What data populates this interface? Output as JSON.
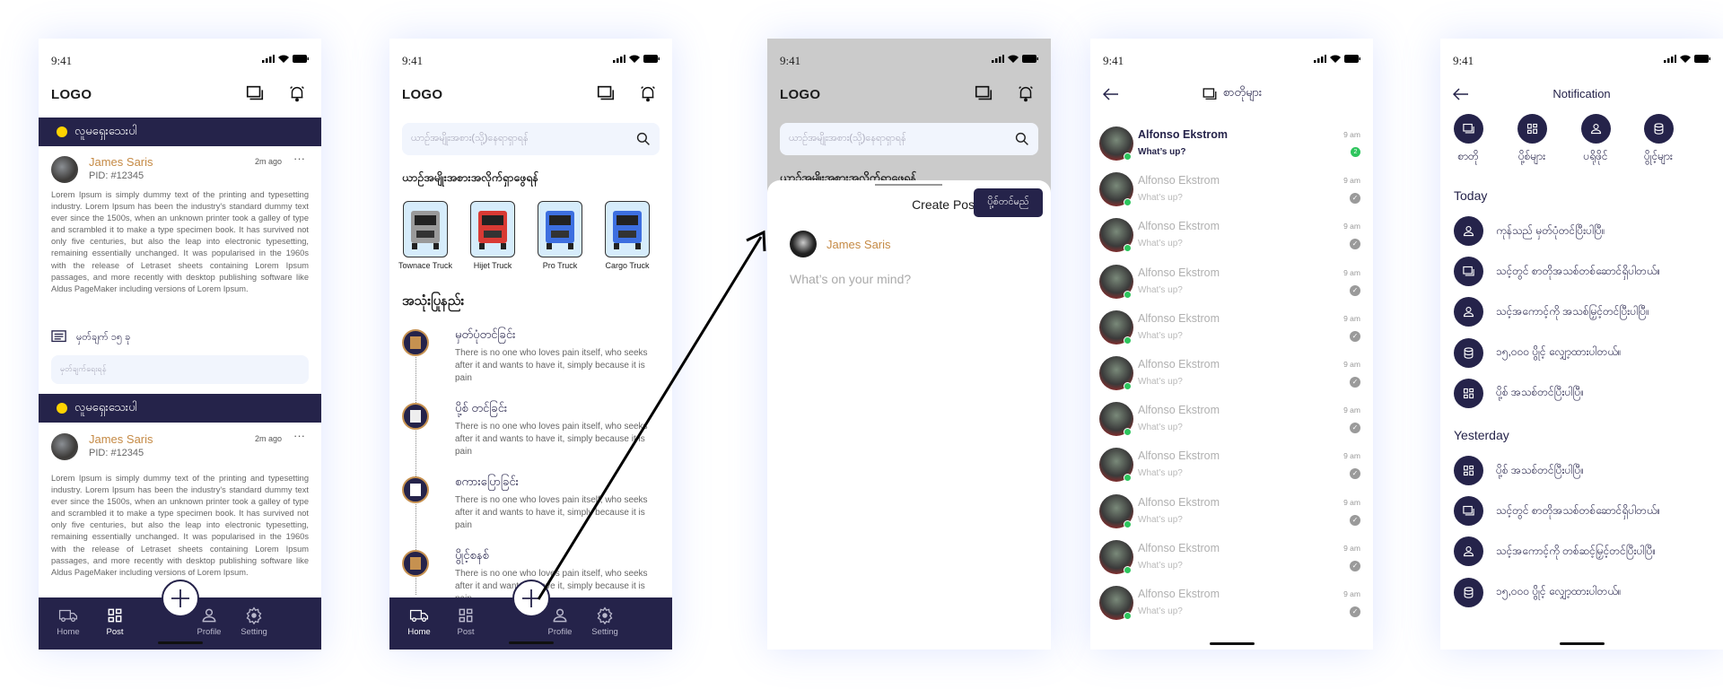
{
  "status_time": "9:41",
  "logo": "LOGO",
  "colors": {
    "primary": "#25234a",
    "accent": "#c58a45",
    "online": "#2ec55d",
    "banner_dot": "#ffd400"
  },
  "feed": {
    "posts": [
      {
        "banner": "လူမရှေးသေးပါ",
        "name": "James Saris",
        "pid": "PID: #12345",
        "time": "2m ago",
        "body": "Lorem Ipsum is simply dummy text of the printing and typesetting industry. Lorem Ipsum has been the industry's standard dummy text ever since the 1500s, when an unknown printer took a galley of type and scrambled it to make a type specimen book. It has survived not only five centuries, but also the leap into electronic typesetting, remaining essentially unchanged. It was popularised in the 1960s with the release of Letraset sheets containing Lorem Ipsum passages, and more recently with desktop publishing software like Aldus PageMaker including versions of Lorem Ipsum."
      },
      {
        "banner": "လူမရှေးသေးပါ",
        "name": "James Saris",
        "pid": "PID: #12345",
        "time": "2m ago",
        "body": "Lorem Ipsum is simply dummy text of the printing and typesetting industry. Lorem Ipsum has been the industry's standard dummy text ever since the 1500s, when an unknown printer took a galley of type and scrambled it to make a type specimen book. It has survived not only five centuries, but also the leap into electronic typesetting, remaining essentially unchanged. It was popularised in the 1960s with the release of Letraset sheets containing Lorem Ipsum passages, and more recently with desktop publishing software like Aldus PageMaker including versions of Lorem Ipsum."
      }
    ],
    "comment_count": "မှတ်ချက် ၁၅ ခု",
    "comment_placeholder": "မှတ်ချက်ရေးရန်"
  },
  "nav": [
    {
      "label": "Home",
      "icon": "truck-icon"
    },
    {
      "label": "Post",
      "icon": "grid-icon"
    },
    {
      "label": "Profile",
      "icon": "user-icon"
    },
    {
      "label": "Setting",
      "icon": "gear-icon"
    }
  ],
  "home": {
    "search_placeholder": "ယာဉ်အမျိုးအစား(သို့)နေရာရှာရန်",
    "trucks_title": "ယာဉ်အမျိုးအစားအလိုက်ရှာဖွေရန်",
    "trucks": [
      {
        "label": "Townace Truck",
        "color": "#9a9a9a"
      },
      {
        "label": "Hijet Truck",
        "color": "#d93a34"
      },
      {
        "label": "Pro Truck",
        "color": "#3d6fe0"
      },
      {
        "label": "Cargo Truck",
        "color": "#3d6fe0"
      }
    ],
    "howto_title": "အသုံးပြုနည်း",
    "steps": [
      {
        "title": "မှတ်ပုံတင်ခြင်း",
        "desc": "There is no one who loves pain itself, who seeks after it and wants to have it, simply because it is pain"
      },
      {
        "title": "ပို့စ် တင်ခြင်း",
        "desc": "There is no one who loves pain itself, who seeks after it and wants to have it, simply because it is pain"
      },
      {
        "title": "စကားပြောခြင်း",
        "desc": "There is no one who loves pain itself, who seeks after it and wants to have it, simply because it is pain"
      },
      {
        "title": "ပွိုင့်စနစ်",
        "desc": "There is no one who loves pain itself, who seeks after it and wants to have it, simply because it is pain"
      }
    ]
  },
  "create_post": {
    "title": "Create Post",
    "submit": "ပို့စ်တင်မည်",
    "name": "James Saris",
    "placeholder": "What’s on your mind?"
  },
  "chats": {
    "title": "စာတိုများ",
    "items": [
      {
        "name": "Alfonso Ekstrom",
        "msg": "What’s up?",
        "time": "9 am",
        "unread": "2"
      },
      {
        "name": "Alfonso Ekstrom",
        "msg": "What’s up?",
        "time": "9 am"
      },
      {
        "name": "Alfonso Ekstrom",
        "msg": "What’s up?",
        "time": "9 am"
      },
      {
        "name": "Alfonso Ekstrom",
        "msg": "What’s up?",
        "time": "9 am"
      },
      {
        "name": "Alfonso Ekstrom",
        "msg": "What’s up?",
        "time": "9 am"
      },
      {
        "name": "Alfonso Ekstrom",
        "msg": "What’s up?",
        "time": "9 am"
      },
      {
        "name": "Alfonso Ekstrom",
        "msg": "What’s up?",
        "time": "9 am"
      },
      {
        "name": "Alfonso Ekstrom",
        "msg": "What’s up?",
        "time": "9 am"
      },
      {
        "name": "Alfonso Ekstrom",
        "msg": "What’s up?",
        "time": "9 am"
      },
      {
        "name": "Alfonso Ekstrom",
        "msg": "What’s up?",
        "time": "9 am"
      },
      {
        "name": "Alfonso Ekstrom",
        "msg": "What’s up?",
        "time": "9 am"
      }
    ]
  },
  "notifications": {
    "title": "Notification",
    "categories": [
      {
        "label": "စာတို",
        "icon": "chat-icon"
      },
      {
        "label": "ပို့စ်များ",
        "icon": "grid-icon"
      },
      {
        "label": "ပရိုဖိုင်",
        "icon": "user-icon"
      },
      {
        "label": "ပွိုင့်များ",
        "icon": "database-icon"
      }
    ],
    "today_label": "Today",
    "today": [
      {
        "text": "ကုန်သည် မှတ်ပုံတင်ပြီးပါပြီ။",
        "icon": "user-icon"
      },
      {
        "text": "သင့်တွင် စာတိုအသစ်တစ်ဆောင်ရှိပါတယ်။",
        "icon": "chat-icon"
      },
      {
        "text": "သင့်အကောင့်ကို အသစ်မြှင့်တင်ပြီးပါပြီ။",
        "icon": "user-icon"
      },
      {
        "text": "၁၅,၀၀၀ ပွိုင့် လျှော့ထားပါတယ်။",
        "icon": "database-icon"
      },
      {
        "text": "ပို့စ် အသစ်တင်ပြီးပါပြီ။",
        "icon": "grid-icon"
      }
    ],
    "yesterday_label": "Yesterday",
    "yesterday": [
      {
        "text": "ပို့စ် အသစ်တင်ပြီးပါပြီ။",
        "icon": "grid-icon"
      },
      {
        "text": "သင့်တွင် စာတိုအသစ်တစ်ဆောင်ရှိပါတယ်။",
        "icon": "chat-icon"
      },
      {
        "text": "သင့်အကောင့်ကို တစ်ဆင့်မြှင့်တင်ပြီးပါပြီ။",
        "icon": "user-icon"
      },
      {
        "text": "၁၅,၀၀၀ ပွိုင့် လျှော့ထားပါတယ်။",
        "icon": "database-icon"
      }
    ]
  }
}
